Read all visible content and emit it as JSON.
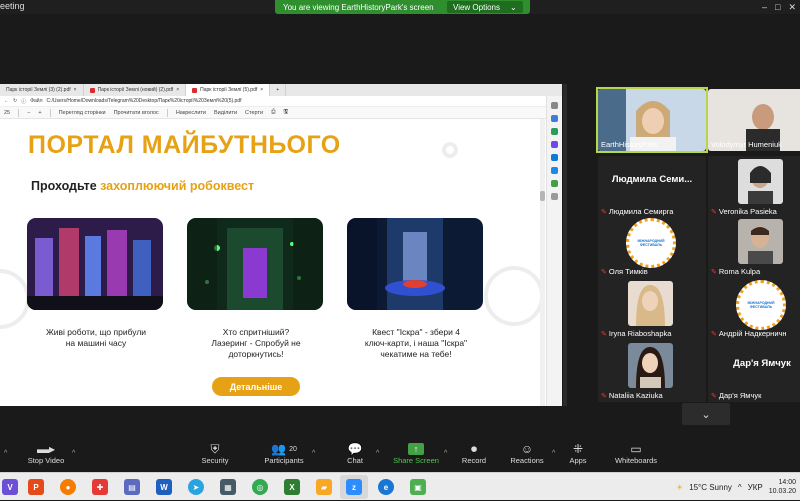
{
  "window": {
    "title": "eeting"
  },
  "share_banner": {
    "message": "You are viewing EarthHistoryPark's screen",
    "options_label": "View Options"
  },
  "browser": {
    "tabs": [
      {
        "label": "Парк історії Землі (3) (2).pdf"
      },
      {
        "label": "Парк історії Землі (новий) (2).рdf"
      },
      {
        "label": "Парк історії Землі (5).pdf"
      }
    ],
    "address": {
      "file_label": "Файл",
      "url": "C:/Users/Home/Downloads/Telegram%20Desktop/Парк%20історії%20Землі%20(5).pdf"
    },
    "pdf_toolbar": {
      "page": "25",
      "items": [
        "Перегляд сторінки",
        "Прочитати вголос",
        "Накреслити",
        "Виділити",
        "Стерти"
      ]
    }
  },
  "pdf": {
    "title": "ПОРТАЛ МАЙБУТНЬОГО",
    "subtitle_plain": "Проходьте ",
    "subtitle_highlight": "захоплюючий робоквест",
    "cards": [
      {
        "line1": "Живі роботи, що прибули",
        "line2": "на машині часу",
        "line3": ""
      },
      {
        "line1": "Хто спритніший?",
        "line2": "Лазеринг - Спробуй не",
        "line3": "доторкнутись!"
      },
      {
        "line1": "Квест \"Іскра\" - збери 4",
        "line2": "ключ-карти, і наша \"Іскра\"",
        "line3": "чекатиме на тебе!"
      }
    ],
    "more_button": "Детальніше"
  },
  "participants": [
    {
      "name": "EarthHistoryPark",
      "big": "",
      "type": "photo",
      "muted": false
    },
    {
      "name": "Volodymyr Humeniuk",
      "big": "",
      "type": "photo",
      "muted": false
    },
    {
      "name": "Людмила Семирга",
      "big": "Людмила Семи...",
      "type": "name",
      "muted": true
    },
    {
      "name": "Veronika Pasieka",
      "big": "",
      "type": "photo",
      "muted": true
    },
    {
      "name": "Оля Тимків",
      "big": "",
      "type": "logo",
      "muted": true
    },
    {
      "name": "Roma Kulpa",
      "big": "",
      "type": "photo",
      "muted": true
    },
    {
      "name": "Iryna Riaboshapka",
      "big": "",
      "type": "photo",
      "muted": true
    },
    {
      "name": "Андрій Надкерничн",
      "big": "",
      "type": "logo",
      "muted": true
    },
    {
      "name": "Nataliia Kaziuka",
      "big": "",
      "type": "photo",
      "muted": true
    },
    {
      "name": "Дар'я Ямчук",
      "big": "Дар'я Ямчук",
      "type": "name",
      "muted": true
    }
  ],
  "controls": {
    "stop_video": "Stop Video",
    "security": "Security",
    "participants": "Participants",
    "participants_count": "20",
    "chat": "Chat",
    "share_screen": "Share Screen",
    "record": "Record",
    "reactions": "Reactions",
    "apps": "Apps",
    "whiteboards": "Whiteboards"
  },
  "taskbar": {
    "weather": "15°C  Sunny",
    "language": "УКР",
    "time": "14:00",
    "date": "10.03.20"
  },
  "colors": {
    "accent": "#e6a214",
    "share_green": "#2f8f2f",
    "active_speaker": "#b7d74a"
  }
}
